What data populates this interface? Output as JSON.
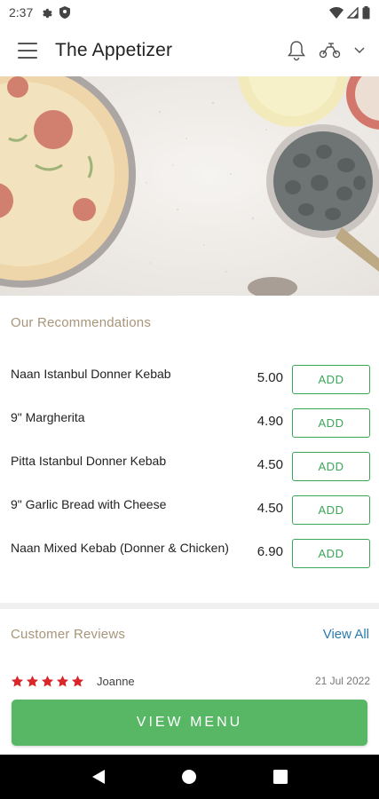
{
  "status_bar": {
    "time": "2:37"
  },
  "app_bar": {
    "title": "The Appetizer"
  },
  "recommendations": {
    "title": "Our Recommendations",
    "items": [
      {
        "name": "Naan Istanbul Donner Kebab",
        "price": "5.00",
        "button": "ADD"
      },
      {
        "name": "9\" Margherita",
        "price": "4.90",
        "button": "ADD"
      },
      {
        "name": "Pitta Istanbul Donner Kebab",
        "price": "4.50",
        "button": "ADD"
      },
      {
        "name": "9\" Garlic Bread with Cheese",
        "price": "4.50",
        "button": "ADD"
      },
      {
        "name": "Naan Mixed Kebab (Donner & Chicken)",
        "price": "6.90",
        "button": "ADD"
      }
    ]
  },
  "reviews": {
    "title": "Customer Reviews",
    "view_all": "View All",
    "items": [
      {
        "reviewer": "Joanne",
        "rating": 5,
        "date": "21 Jul 2022"
      }
    ]
  },
  "view_menu_label": "VIEW MENU",
  "colors": {
    "accent_green": "#58b764",
    "star_red": "#d9262a",
    "section_title": "#a8957a",
    "link_blue": "#2b7bb0"
  },
  "icons": [
    "settings-icon",
    "shield-icon",
    "wifi-icon",
    "signal-icon",
    "battery-icon",
    "menu-icon",
    "bell-icon",
    "scooter-icon",
    "chevron-down-icon",
    "back-icon",
    "home-icon",
    "recents-icon"
  ]
}
